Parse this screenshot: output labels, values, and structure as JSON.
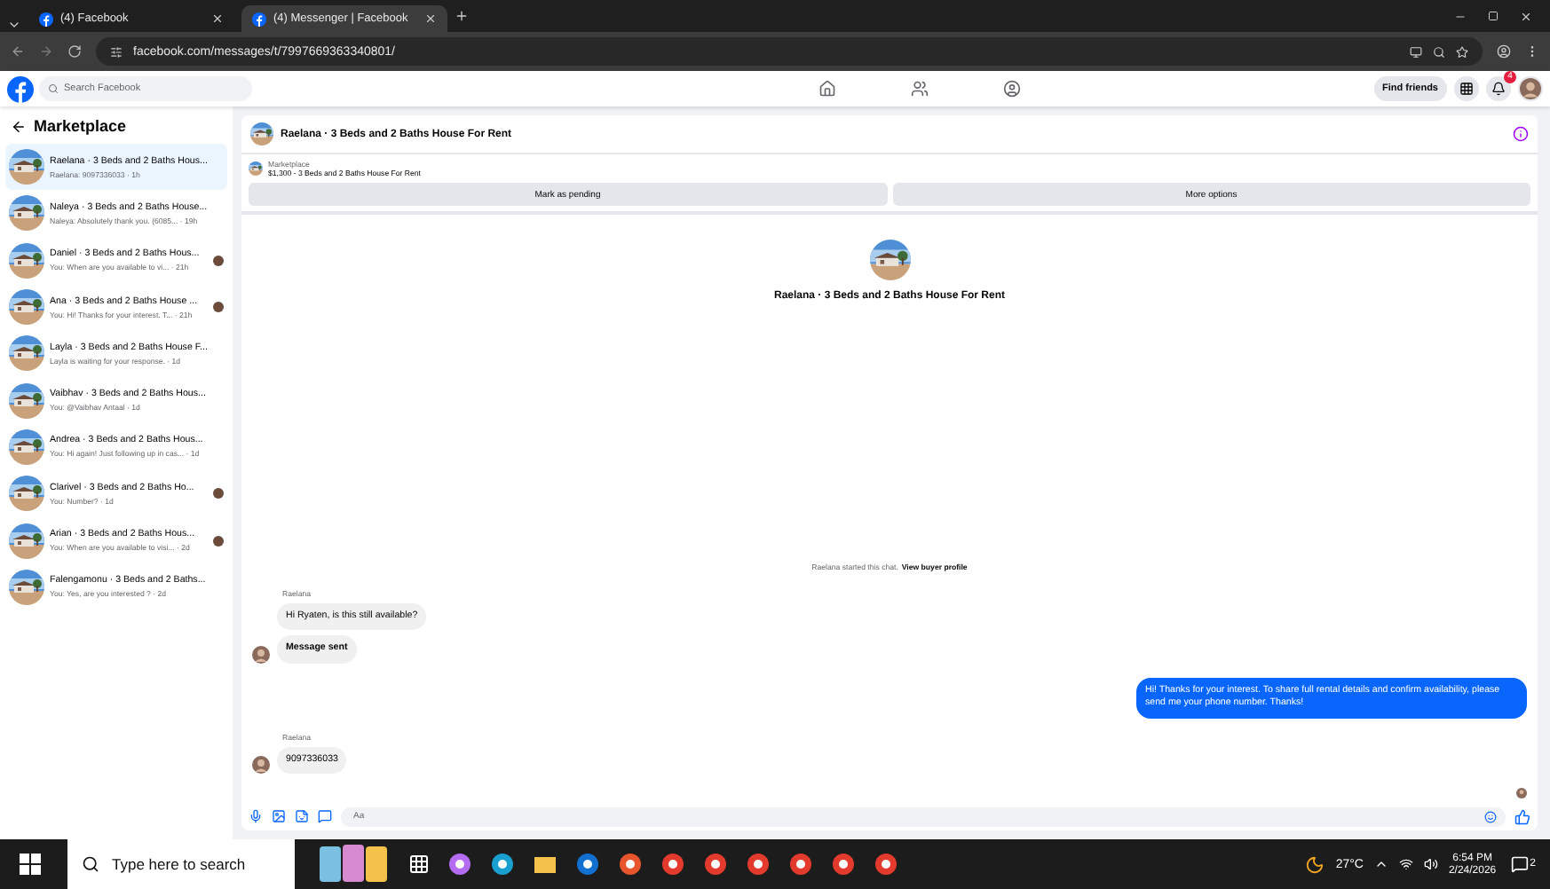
{
  "browser": {
    "tabs": [
      {
        "title": "(4) Facebook",
        "selected": false
      },
      {
        "title": "(4) Messenger | Facebook",
        "selected": true
      }
    ],
    "url": "facebook.com/messages/t/7997669363340801/"
  },
  "topbar": {
    "search_placeholder": "Search Facebook",
    "find_friends": "Find friends",
    "notification_count": "4"
  },
  "sidebar": {
    "title": "Marketplace",
    "conversations": [
      {
        "title": "Raelana · 3 Beds and 2 Baths Hous...",
        "preview": "Raelana: 9097336033 · 1h",
        "selected": true,
        "seen": false
      },
      {
        "title": "Naleya · 3 Beds and 2 Baths House...",
        "preview": "Naleya: Absolutely thank you. (6085... · 19h",
        "selected": false,
        "seen": false
      },
      {
        "title": "Daniel · 3 Beds and 2 Baths Hous...",
        "preview": "You: When are you available to vi... · 21h",
        "selected": false,
        "seen": true
      },
      {
        "title": "Ana · 3 Beds and 2 Baths House ...",
        "preview": "You: Hi! Thanks for your interest. T... · 21h",
        "selected": false,
        "seen": true
      },
      {
        "title": "Layla · 3 Beds and 2 Baths House F...",
        "preview": "Layla is waiting for your response. · 1d",
        "selected": false,
        "seen": false
      },
      {
        "title": "Vaibhav · 3 Beds and 2 Baths Hous...",
        "preview": "You: @Vaibhav Antaal · 1d",
        "selected": false,
        "seen": false
      },
      {
        "title": "Andrea · 3 Beds and 2 Baths Hous...",
        "preview": "You: Hi again! Just following up in cas... · 1d",
        "selected": false,
        "seen": false
      },
      {
        "title": "Clarivel · 3 Beds and 2 Baths Ho...",
        "preview": "You: Number? · 1d",
        "selected": false,
        "seen": true
      },
      {
        "title": "Arian · 3 Beds and 2 Baths Hous...",
        "preview": "You: When are you available to visi... · 2d",
        "selected": false,
        "seen": true
      },
      {
        "title": "Falengamonu · 3 Beds and 2 Baths...",
        "preview": "You: Yes, are you interested ? · 2d",
        "selected": false,
        "seen": false
      }
    ]
  },
  "chat": {
    "title": "Raelana · 3 Beds and 2 Baths House For Rent",
    "listing": {
      "label": "Marketplace",
      "title": "$1,300 - 3 Beds and 2 Baths House For Rent"
    },
    "actions": [
      "Mark as pending",
      "More options"
    ],
    "intro_title": "Raelana · 3 Beds and 2 Baths House For Rent",
    "started": {
      "text": "Raelana started this chat.",
      "link": "View buyer profile"
    },
    "groups": [
      {
        "kind": "incoming",
        "sender": "Raelana",
        "messages": [
          {
            "text": "Hi Ryaten, is this still available?",
            "bold": false
          },
          {
            "text": "Message sent",
            "bold": true
          }
        ]
      },
      {
        "kind": "outgoing",
        "messages": [
          {
            "text": "Hi! Thanks for your interest. To share full rental details and confirm availability, please send me your phone number. Thanks!",
            "bold": false
          }
        ]
      },
      {
        "kind": "incoming",
        "sender": "Raelana",
        "messages": [
          {
            "text": "9097336033",
            "bold": false
          }
        ]
      }
    ],
    "seen": true,
    "composer_placeholder": "Aa"
  },
  "taskbar": {
    "search_placeholder": "Type here to search",
    "temperature": "27°C",
    "time": "6:54 PM",
    "date": "2/24/2026",
    "notification_count": "2"
  }
}
